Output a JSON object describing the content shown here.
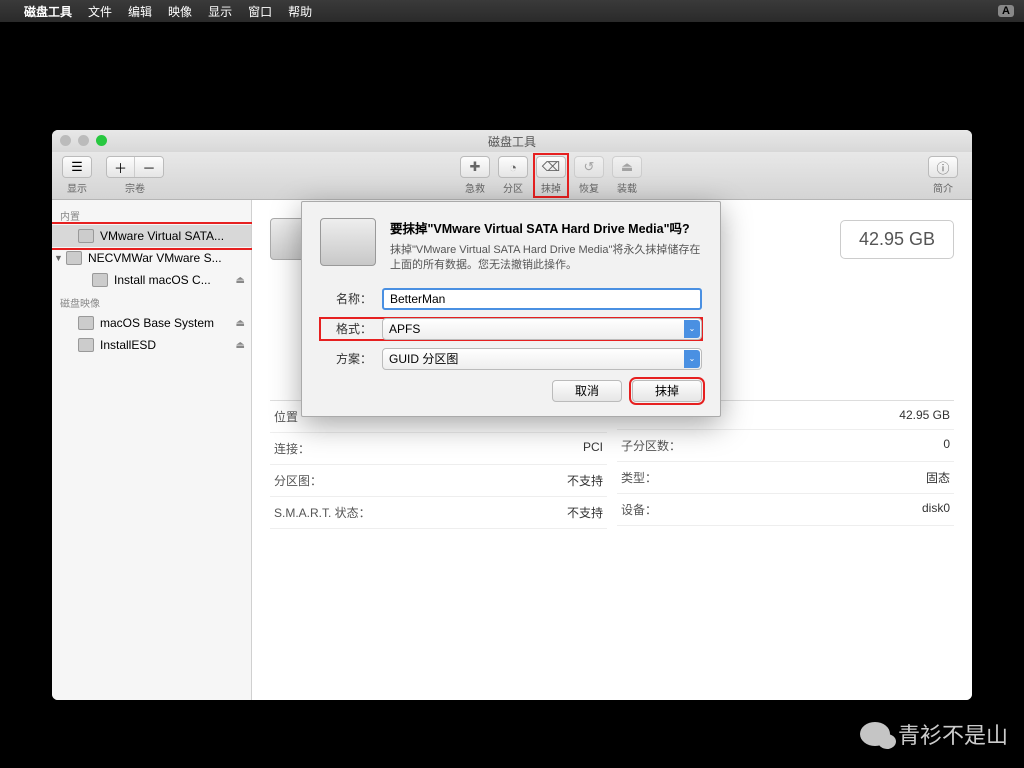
{
  "menubar": {
    "app": "磁盘工具",
    "items": [
      "文件",
      "编辑",
      "映像",
      "显示",
      "窗口",
      "帮助"
    ],
    "input_indicator": "A"
  },
  "window": {
    "title": "磁盘工具"
  },
  "toolbar": {
    "view_label": "显示",
    "volume_label": "宗卷",
    "first_aid": "急救",
    "partition": "分区",
    "erase": "抹掉",
    "restore": "恢复",
    "mount": "装载",
    "info": "简介"
  },
  "sidebar": {
    "internal_header": "内置",
    "disk_images_header": "磁盘映像",
    "items": [
      {
        "label": "VMware Virtual SATA..."
      },
      {
        "label": "NECVMWar VMware S..."
      },
      {
        "label": "Install macOS C..."
      },
      {
        "label": "macOS Base System"
      },
      {
        "label": "InstallESD"
      }
    ]
  },
  "content": {
    "disk_name_suffix": "Media",
    "capacity": "42.95 GB",
    "rows_left": [
      {
        "k": "位置",
        "v": ""
      },
      {
        "k": "连接：",
        "v": "PCI"
      },
      {
        "k": "分区图：",
        "v": "不支持"
      },
      {
        "k": "S.M.A.R.T. 状态：",
        "v": "不支持"
      }
    ],
    "rows_right": [
      {
        "k": "",
        "v": "42.95 GB"
      },
      {
        "k": "子分区数：",
        "v": "0"
      },
      {
        "k": "类型：",
        "v": "固态"
      },
      {
        "k": "设备：",
        "v": "disk0"
      }
    ]
  },
  "dialog": {
    "title": "要抹掉\"VMware Virtual SATA Hard Drive Media\"吗?",
    "desc": "抹掉\"VMware Virtual SATA Hard Drive Media\"将永久抹掉储存在上面的所有数据。您无法撤销此操作。",
    "name_label": "名称：",
    "name_value": "BetterMan",
    "format_label": "格式：",
    "format_value": "APFS",
    "scheme_label": "方案：",
    "scheme_value": "GUID 分区图",
    "cancel": "取消",
    "erase": "抹掉"
  },
  "watermark": "青衫不是山"
}
